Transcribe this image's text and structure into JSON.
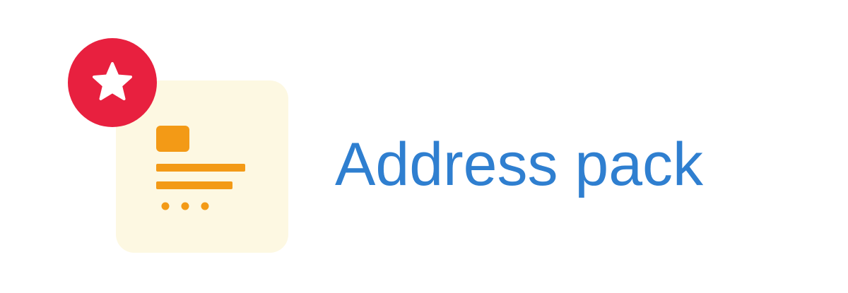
{
  "item": {
    "label": "Address pack",
    "icon": "address-card-icon",
    "badge_icon": "star-icon"
  },
  "colors": {
    "label_link": "#2f7fd0",
    "icon_tile_bg": "#fdf8e2",
    "icon_fg": "#f39a16",
    "badge_bg": "#e8203f",
    "badge_fg": "#ffffff"
  }
}
